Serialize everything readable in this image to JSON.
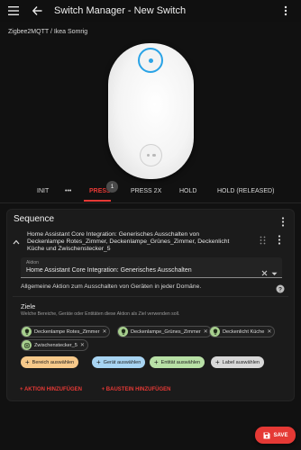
{
  "topbar": {
    "title": "Switch Manager - New Switch"
  },
  "breadcrumb": "Zigbee2MQTT / Ikea Somrig",
  "tabs": {
    "items": [
      "INIT",
      "•••",
      "PRESS",
      "PRESS 2X",
      "HOLD",
      "HOLD (RELEASED)"
    ],
    "badge": "1",
    "active": "PRESS"
  },
  "sequence": {
    "title": "Sequence",
    "action_title": "Home Assistant Core Integration: Generisches Ausschalten von Deckenlampe Rotes_Zimmer, Deckenlampe_Grünes_Zimmer, Deckenlicht Küche und Zwischenstecker_5",
    "select_label": "Aktion",
    "select_value": "Home Assistant Core Integration: Generisches Ausschalten",
    "description": "Allgemeine Aktion zum Ausschalten von Geräten in jeder Domäne.",
    "targets_title": "Ziele",
    "targets_sub": "Welche Bereiche, Geräte oder Entitäten diese Aktion als Ziel verwenden soll.",
    "chips": [
      "Deckenlampe Rotes_Zimmer",
      "Deckenlampe_Grünes_Zimmer",
      "Deckenlicht Küche",
      "Zwischenstecker_5"
    ],
    "pickers": {
      "area": "Bereich auswählen",
      "device": "Gerät auswählen",
      "entity": "Entität auswählen",
      "label": "Label auswählen"
    },
    "add_action": "AKTION HINZUFÜGEN",
    "add_building_block": "BAUSTEIN HINZUFÜGEN"
  },
  "save_label": "SAVE",
  "colors": {
    "accent": "#e53935",
    "device_highlight": "#29a3e6"
  }
}
